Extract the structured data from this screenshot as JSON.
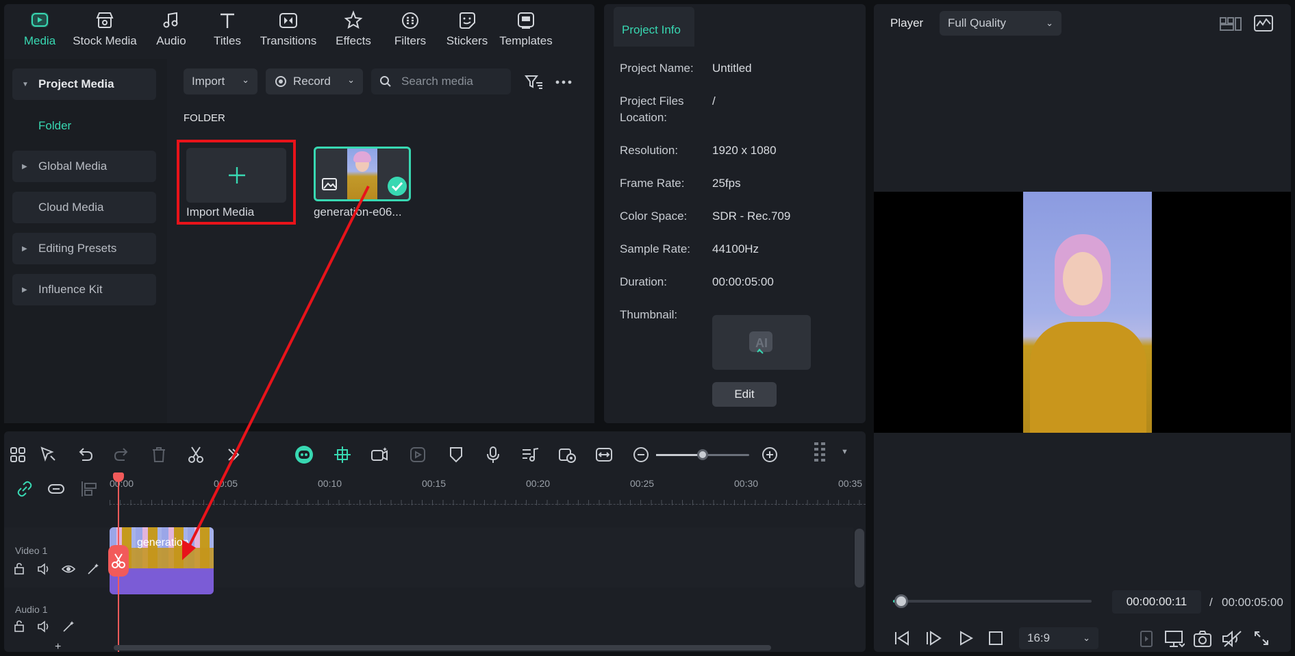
{
  "top_tabs": [
    {
      "label": "Media",
      "icon": "media-icon",
      "active": true
    },
    {
      "label": "Stock Media",
      "icon": "stock-media-icon"
    },
    {
      "label": "Audio",
      "icon": "audio-icon"
    },
    {
      "label": "Titles",
      "icon": "titles-icon"
    },
    {
      "label": "Transitions",
      "icon": "transitions-icon"
    },
    {
      "label": "Effects",
      "icon": "effects-icon"
    },
    {
      "label": "Filters",
      "icon": "filters-icon"
    },
    {
      "label": "Stickers",
      "icon": "stickers-icon"
    },
    {
      "label": "Templates",
      "icon": "templates-icon"
    }
  ],
  "sidebar": {
    "items": [
      {
        "label": "Project Media"
      },
      {
        "label": "Folder"
      },
      {
        "label": "Global Media"
      },
      {
        "label": "Cloud Media"
      },
      {
        "label": "Editing Presets"
      },
      {
        "label": "Influence Kit"
      }
    ]
  },
  "media": {
    "import_label": "Import",
    "record_label": "Record",
    "search_placeholder": "Search media",
    "folder_heading": "FOLDER",
    "import_tile_label": "Import Media",
    "clip_name": "generation-e06..."
  },
  "info": {
    "tab": "Project Info",
    "rows": [
      {
        "label": "Project Name:",
        "value": "Untitled"
      },
      {
        "label": "Project Files Location:",
        "value": "/"
      },
      {
        "label": "Resolution:",
        "value": "1920 x 1080"
      },
      {
        "label": "Frame Rate:",
        "value": "25fps"
      },
      {
        "label": "Color Space:",
        "value": "SDR - Rec.709"
      },
      {
        "label": "Sample Rate:",
        "value": "44100Hz"
      },
      {
        "label": "Duration:",
        "value": "00:00:05:00"
      },
      {
        "label": "Thumbnail:",
        "value": ""
      }
    ],
    "edit_label": "Edit"
  },
  "player": {
    "title": "Player",
    "quality": "Full Quality",
    "current_time": "00:00:00:11",
    "separator": "/",
    "total_time": "00:00:05:00",
    "aspect": "16:9",
    "progress": 0.04
  },
  "timeline": {
    "ruler": [
      "00:00",
      "00:05",
      "00:10",
      "00:15",
      "00:20",
      "00:25",
      "00:30",
      "00:35"
    ],
    "tracks": [
      {
        "label": "Video 1"
      },
      {
        "label": "Audio 1"
      }
    ],
    "clip_label": "generation-",
    "add_label": "+"
  },
  "colors": {
    "accent": "#38d8b2",
    "highlight": "#e8131a",
    "playhead": "#f25a5a",
    "clip": "#7b5cd6"
  }
}
